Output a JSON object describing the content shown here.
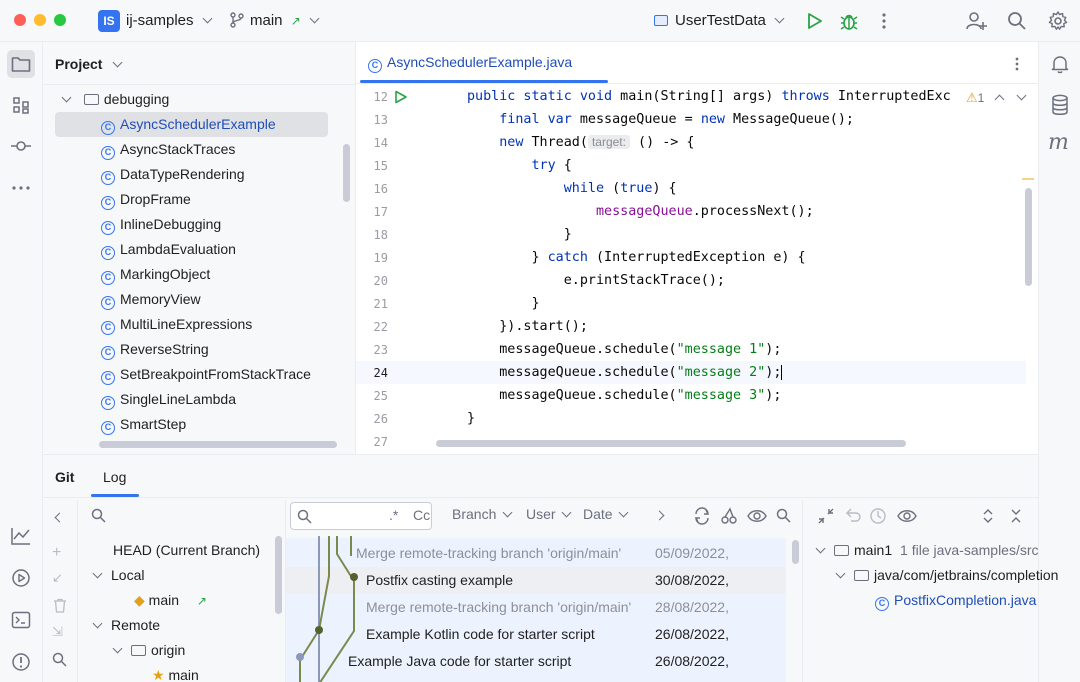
{
  "titlebar": {
    "project_badge": "IS",
    "project_name": "ij-samples",
    "branch": "main",
    "run_config": "UserTestData"
  },
  "project_panel": {
    "title": "Project",
    "folder": "debugging",
    "items": [
      "AsyncSchedulerExample",
      "AsyncStackTraces",
      "DataTypeRendering",
      "DropFrame",
      "InlineDebugging",
      "LambdaEvaluation",
      "MarkingObject",
      "MemoryView",
      "MultiLineExpressions",
      "ReverseString",
      "SetBreakpointFromStackTrace",
      "SingleLineLambda",
      "SmartStep"
    ]
  },
  "editor": {
    "tab": "AsyncSchedulerExample.java",
    "warning_count": "1",
    "line_numbers": [
      "12",
      "13",
      "14",
      "15",
      "16",
      "17",
      "18",
      "19",
      "20",
      "21",
      "22",
      "23",
      "24",
      "25",
      "26",
      "27"
    ],
    "param_hint": "target:",
    "strings": [
      "\"message 1\"",
      "\"message 2\"",
      "\"message 3\""
    ]
  },
  "bottom": {
    "tabs": [
      "Git",
      "Log"
    ],
    "branches": {
      "head": "HEAD (Current Branch)",
      "local": "Local",
      "local_main": "main",
      "remote": "Remote",
      "origin": "origin",
      "origin_main": "main"
    },
    "log": {
      "search_regex": ".*",
      "search_case": "Cc",
      "filters": [
        "Branch",
        "User",
        "Date"
      ],
      "commits": [
        {
          "message": "Merge remote-tracking branch 'origin/main'",
          "date": "05/09/2022,"
        },
        {
          "message": "Postfix casting example",
          "date": "30/08/2022,"
        },
        {
          "message": "Merge remote-tracking branch 'origin/main'",
          "date": "28/08/2022,"
        },
        {
          "message": "Example Kotlin code for starter script",
          "date": "26/08/2022,"
        },
        {
          "message": "Example Java code for starter script",
          "date": "26/08/2022,"
        }
      ]
    },
    "details": {
      "root": "main1",
      "summary": "1 file  java-samples/src",
      "path": "java/com/jetbrains/completion",
      "file": "PostfixCompletion.java"
    }
  },
  "colors": {
    "accent": "#3574f0",
    "keyword": "#0033b3",
    "string": "#067d17",
    "field": "#871094",
    "run_green": "#2aa347",
    "graph_olive": "#7a8a4f"
  }
}
